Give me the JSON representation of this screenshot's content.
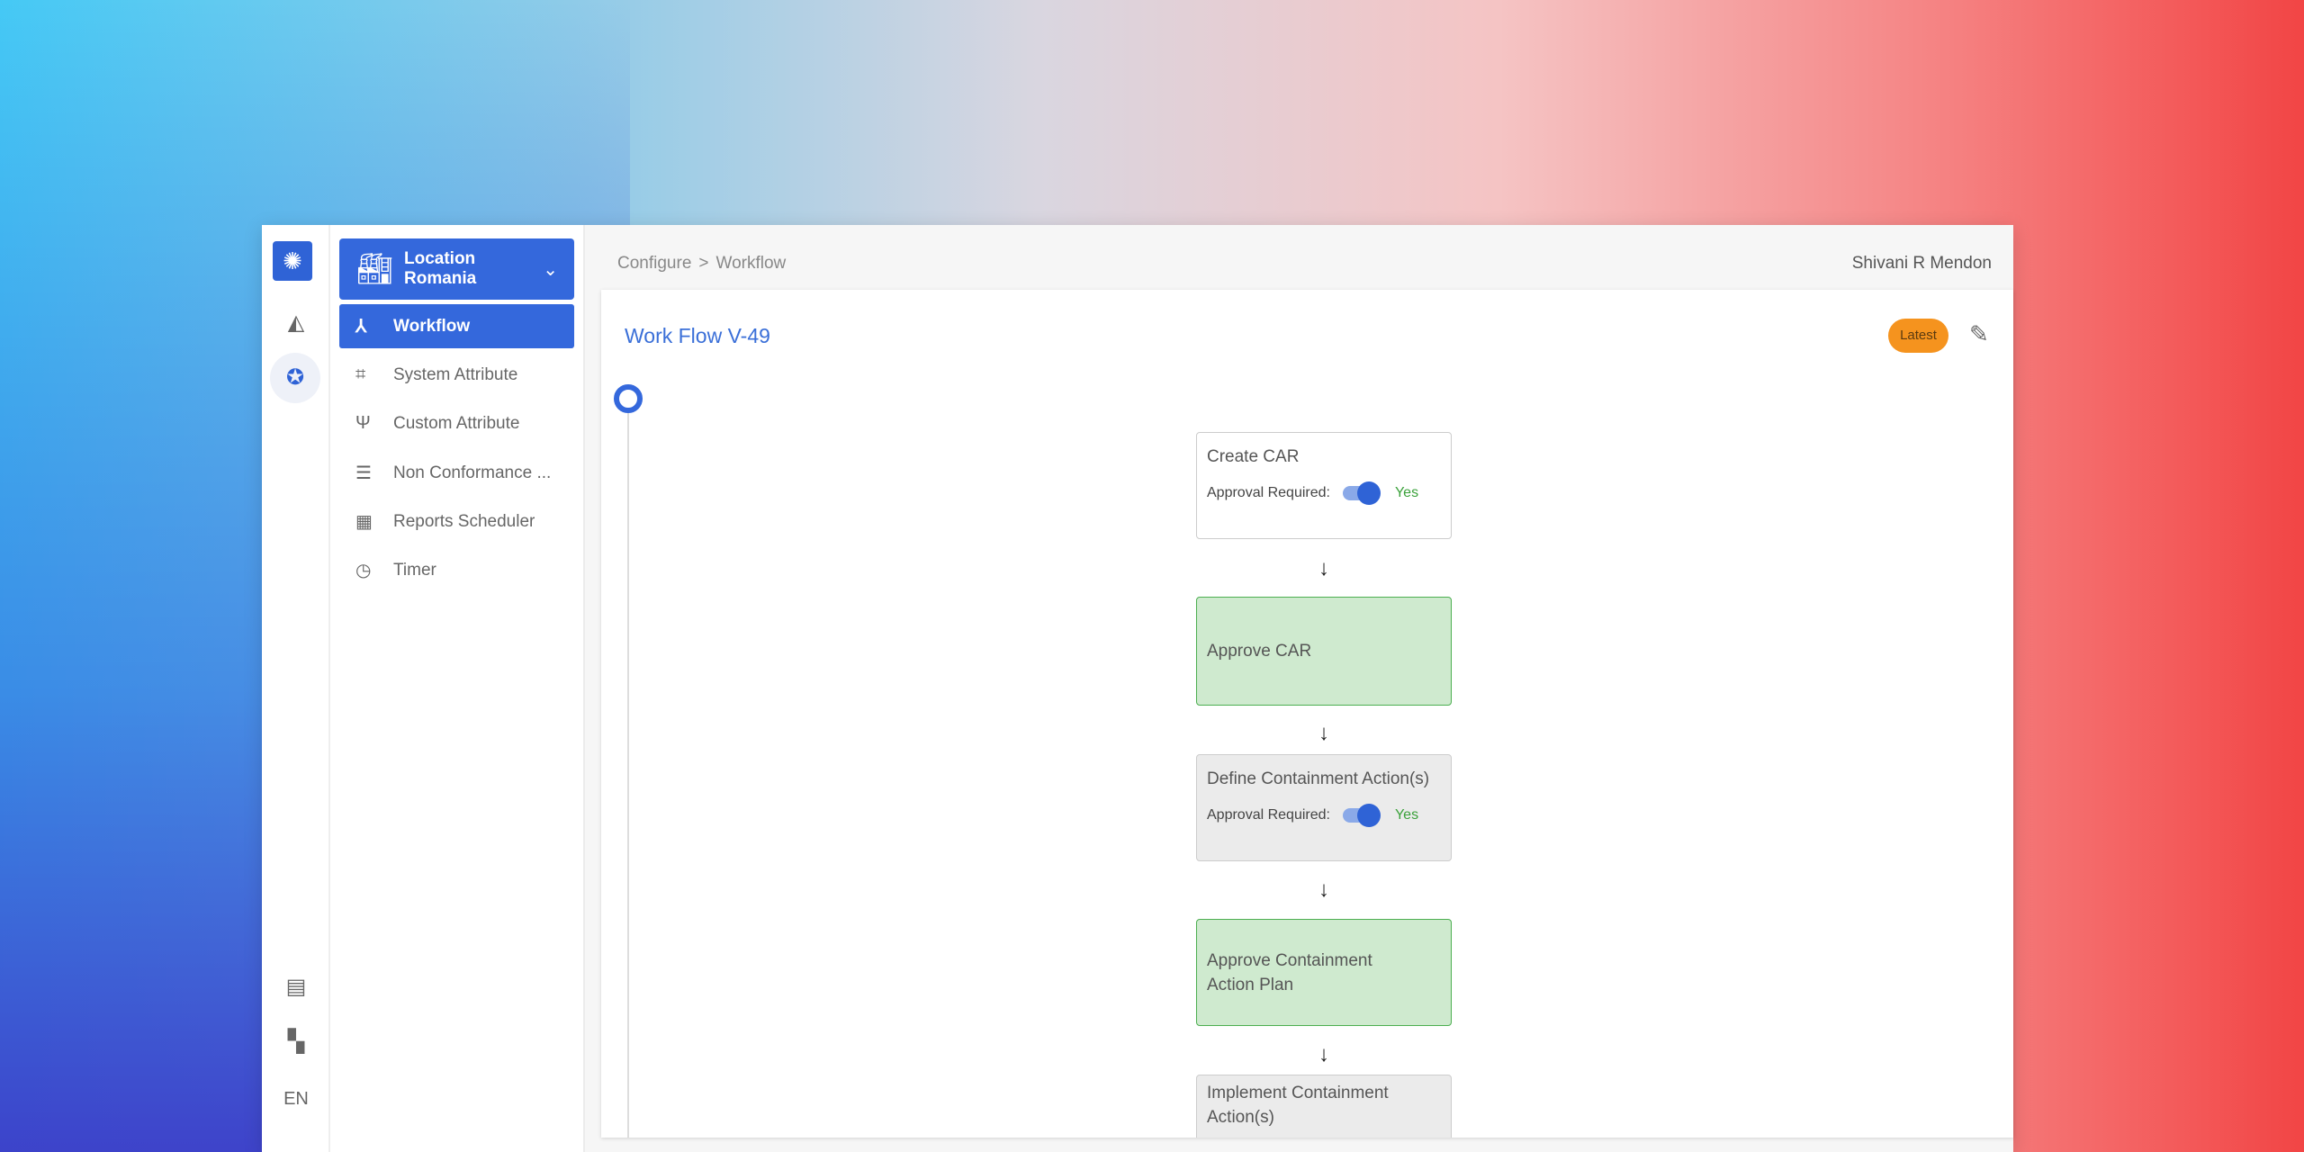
{
  "rail": {
    "lang": "EN"
  },
  "location": {
    "label": "Location",
    "value": "Romania"
  },
  "sidebar": {
    "items": [
      {
        "label": "Workflow",
        "icon": "workflow-icon",
        "active": true
      },
      {
        "label": "System Attribute",
        "icon": "chip-icon"
      },
      {
        "label": "Custom Attribute",
        "icon": "usb-icon"
      },
      {
        "label": "Non Conformance ...",
        "icon": "list-icon"
      },
      {
        "label": "Reports Scheduler",
        "icon": "calendar-icon"
      },
      {
        "label": "Timer",
        "icon": "clock-icon"
      }
    ]
  },
  "breadcrumb": {
    "parent": "Configure",
    "sep": ">",
    "current": "Workflow"
  },
  "user": "Shivani R  Mendon",
  "workflow": {
    "title": "Work Flow V-49",
    "badge": "Latest",
    "approval_label": "Approval Required:",
    "nodes": [
      {
        "label": "Create CAR",
        "approval": "Yes"
      },
      {
        "label": "Approve CAR"
      },
      {
        "label": "Define Containment Action(s)",
        "approval": "Yes"
      },
      {
        "label": "Approve Containment Action Plan"
      },
      {
        "label": "Implement Containment Action(s)"
      }
    ]
  },
  "colors": {
    "accent": "#3468dc",
    "badge": "#f5931e",
    "approve_node": "#cfeacf"
  }
}
